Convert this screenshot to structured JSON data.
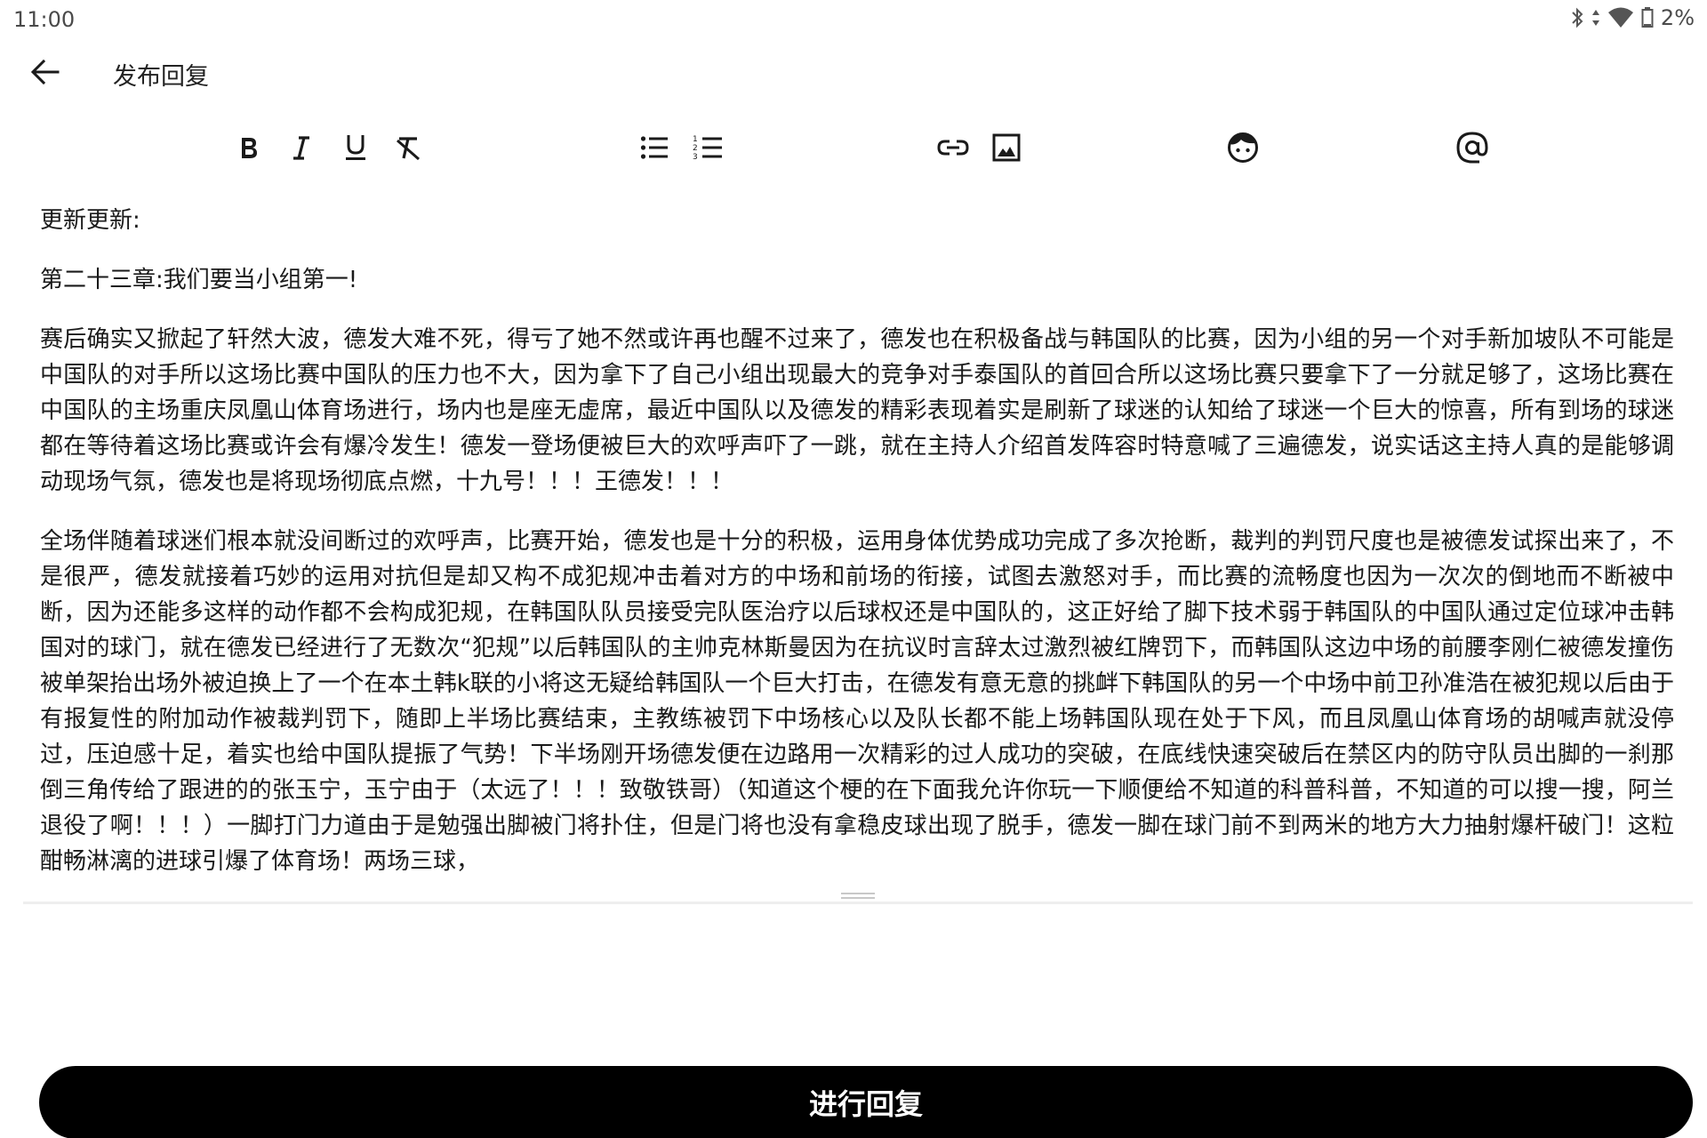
{
  "status_bar": {
    "time": "11:00",
    "battery": "2%",
    "icons": [
      "bluetooth-icon",
      "data-arrows-icon",
      "wifi-icon",
      "battery-icon"
    ]
  },
  "app_bar": {
    "back_icon": "arrow-left-icon",
    "title": "发布回复"
  },
  "toolbar": {
    "tools": [
      {
        "name": "bold",
        "icon": "bold-icon"
      },
      {
        "name": "italic",
        "icon": "italic-icon"
      },
      {
        "name": "underline",
        "icon": "underline-icon"
      },
      {
        "name": "clear-format",
        "icon": "clear-format-icon"
      },
      {
        "name": "bullet-list",
        "icon": "bullet-list-icon"
      },
      {
        "name": "numbered-list",
        "icon": "numbered-list-icon"
      },
      {
        "name": "link",
        "icon": "link-icon"
      },
      {
        "name": "image",
        "icon": "image-icon"
      },
      {
        "name": "emoji",
        "icon": "emoji-icon"
      },
      {
        "name": "mention",
        "icon": "at-icon"
      }
    ]
  },
  "editor": {
    "paragraphs": [
      "更新更新:",
      "第二十三章:我们要当小组第一!",
      "赛后确实又掀起了轩然大波，德发大难不死，得亏了她不然或许再也醒不过来了，德发也在积极备战与韩国队的比赛，因为小组的另一个对手新加坡队不可能是中国队的对手所以这场比赛中国队的压力也不大，因为拿下了自己小组出现最大的竞争对手泰国队的首回合所以这场比赛只要拿下了一分就足够了，这场比赛在中国队的主场重庆凤凰山体育场进行，场内也是座无虚席，最近中国队以及德发的精彩表现着实是刷新了球迷的认知给了球迷一个巨大的惊喜，所有到场的球迷都在等待着这场比赛或许会有爆冷发生！德发一登场便被巨大的欢呼声吓了一跳，就在主持人介绍首发阵容时特意喊了三遍德发，说实话这主持人真的是能够调动现场气氛，德发也是将现场彻底点燃，十九号！！！王德发！！！",
      "全场伴随着球迷们根本就没间断过的欢呼声，比赛开始，德发也是十分的积极，运用身体优势成功完成了多次抢断，裁判的判罚尺度也是被德发试探出来了，不是很严，德发就接着巧妙的运用对抗但是却又构不成犯规冲击着对方的中场和前场的衔接，试图去激怒对手，而比赛的流畅度也因为一次次的倒地而不断被中断，因为还能多这样的动作都不会构成犯规，在韩国队队员接受完队医治疗以后球权还是中国队的，这正好给了脚下技术弱于韩国队的中国队通过定位球冲击韩国对的球门，就在德发已经进行了无数次“犯规”以后韩国队的主帅克林斯曼因为在抗议时言辞太过激烈被红牌罚下，而韩国队这边中场的前腰李刚仁被德发撞伤被单架抬出场外被迫换上了一个在本土韩k联的小将这无疑给韩国队一个巨大打击，在德发有意无意的挑衅下韩国队的另一个中场中前卫孙准浩在被犯规以后由于有报复性的附加动作被裁判罚下，随即上半场比赛结束，主教练被罚下中场核心以及队长都不能上场韩国队现在处于下风，而且凤凰山体育场的胡喊声就没停过，压迫感十足，着实也给中国队提振了气势！下半场刚开场德发便在边路用一次精彩的过人成功的突破，在底线快速突破后在禁区内的防守队员出脚的一刹那倒三角传给了跟进的的张玉宁，玉宁由于（太远了！！！致敬铁哥）（知道这个梗的在下面我允许你玩一下顺便给不知道的科普科普，不知道的可以搜一搜，阿兰退役了啊！！！）一脚打门力道由于是勉强出脚被门将扑住，但是门将也没有拿稳皮球出现了脱手，德发一脚在球门前不到两米的地方大力抽射爆杆破门！这粒酣畅淋漓的进球引爆了体育场！两场三球，"
    ]
  },
  "submit": {
    "label": "进行回复"
  }
}
